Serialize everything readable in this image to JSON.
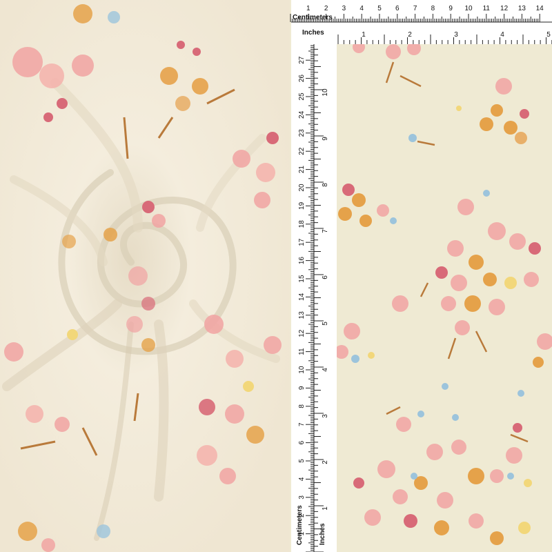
{
  "rulers": {
    "centimeters_label": "Centimeters",
    "inches_label": "Inches",
    "cm_ticks": [
      "1",
      "2",
      "3",
      "4",
      "5",
      "6",
      "7",
      "8",
      "9",
      "10",
      "11",
      "12",
      "13",
      "14"
    ],
    "inch_ticks": [
      "1",
      "2",
      "3",
      "4",
      "5"
    ],
    "vertical_cm_ticks": [
      "1",
      "2",
      "3",
      "4",
      "5",
      "6",
      "7",
      "8",
      "9",
      "10",
      "11",
      "12",
      "13",
      "14",
      "15",
      "16",
      "17",
      "18",
      "19",
      "20",
      "21",
      "22",
      "23",
      "24",
      "25",
      "26",
      "27"
    ],
    "vertical_inch_ticks": [
      "1",
      "2",
      "3",
      "4",
      "5",
      "6",
      "7",
      "8",
      "9",
      "10"
    ]
  },
  "colors": {
    "fabric_base": "#f3ecdc",
    "flat_base": "#efead3",
    "petal_pink": "#f1a3a2",
    "petal_orange": "#e5a24a",
    "leaf_brown": "#b97a3b",
    "bud_rose": "#d86a78",
    "accent_blue": "#9cc4dc",
    "accent_yellow": "#f2d77a"
  }
}
